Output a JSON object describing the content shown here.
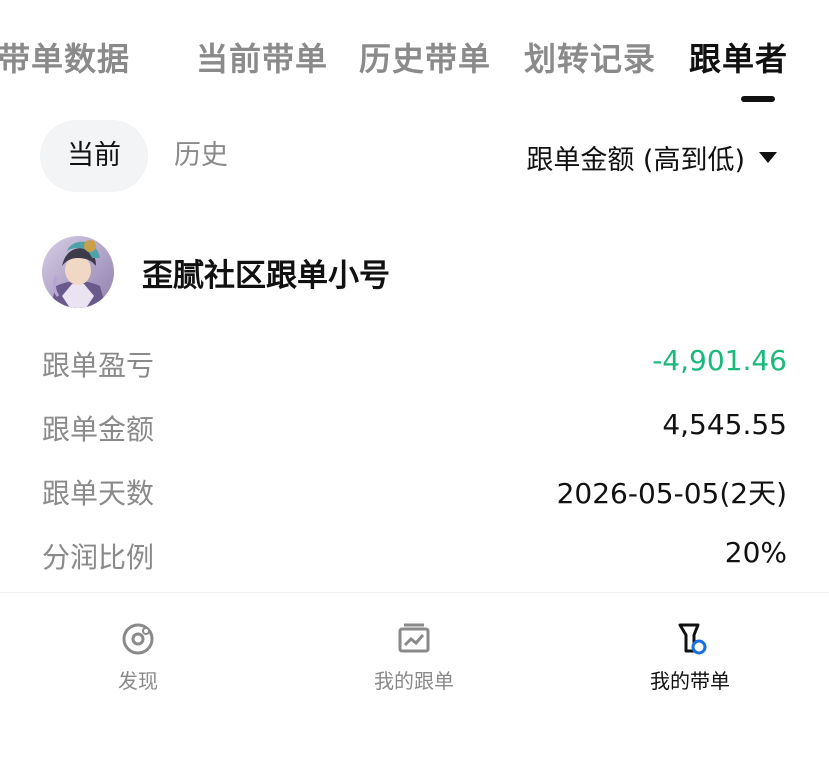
{
  "tabs": [
    {
      "label": "带单数据",
      "active": false
    },
    {
      "label": "当前带单",
      "active": false
    },
    {
      "label": "历史带单",
      "active": false
    },
    {
      "label": "划转记录",
      "active": false
    },
    {
      "label": "跟单者",
      "active": true
    }
  ],
  "segment": {
    "current": "当前",
    "history": "历史"
  },
  "sort": {
    "label": "跟单金额 (高到低)"
  },
  "follower": {
    "name": "歪腻社区跟单小号",
    "rows": [
      {
        "label": "跟单盈亏",
        "value": "-4,901.46",
        "tone": "negative",
        "tone_color": "#19b97c"
      },
      {
        "label": "跟单金额",
        "value": "4,545.55"
      },
      {
        "label": "跟单天数",
        "value": "2026-05-05(2天)"
      },
      {
        "label": "分润比例",
        "value": "20%"
      }
    ]
  },
  "bottom_nav": [
    {
      "label": "发现",
      "icon": "discover-icon",
      "active": false
    },
    {
      "label": "我的跟单",
      "icon": "chart-icon",
      "active": false
    },
    {
      "label": "我的带单",
      "icon": "lead-trade-icon",
      "active": true,
      "accent": "#1a6fe0"
    }
  ]
}
